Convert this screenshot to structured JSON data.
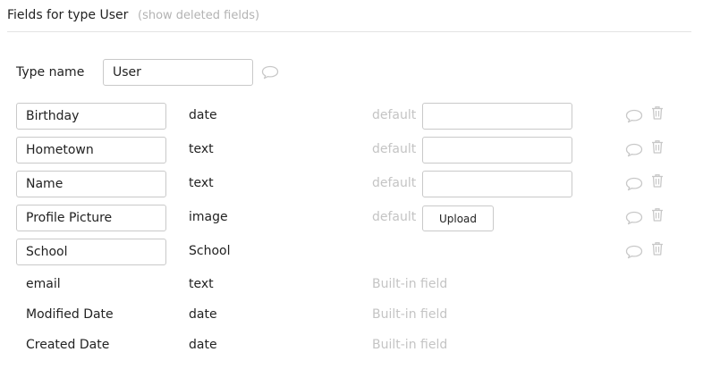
{
  "header": {
    "title": "Fields for type User",
    "show_deleted_link": "(show deleted fields)"
  },
  "type_name": {
    "label": "Type name",
    "value": "User"
  },
  "default_label": "default",
  "upload_label": "Upload",
  "custom_fields": [
    {
      "name": "Birthday",
      "type": "date",
      "has_default": true,
      "default_kind": "input"
    },
    {
      "name": "Hometown",
      "type": "text",
      "has_default": true,
      "default_kind": "input"
    },
    {
      "name": "Name",
      "type": "text",
      "has_default": true,
      "default_kind": "input"
    },
    {
      "name": "Profile Picture",
      "type": "image",
      "has_default": true,
      "default_kind": "upload"
    },
    {
      "name": "School",
      "type": "School",
      "has_default": false,
      "default_kind": "none"
    }
  ],
  "builtin_fields": [
    {
      "name": "email",
      "type": "text",
      "note": "Built-in field"
    },
    {
      "name": "Modified Date",
      "type": "date",
      "note": "Built-in field"
    },
    {
      "name": "Created Date",
      "type": "date",
      "note": "Built-in field"
    }
  ],
  "icons": {
    "comment": "comment-icon",
    "trash": "trash-icon"
  },
  "colors": {
    "text": "#222222",
    "muted": "#b3b3b3",
    "border": "#c9c9c9",
    "icon": "#c8c8c8"
  }
}
